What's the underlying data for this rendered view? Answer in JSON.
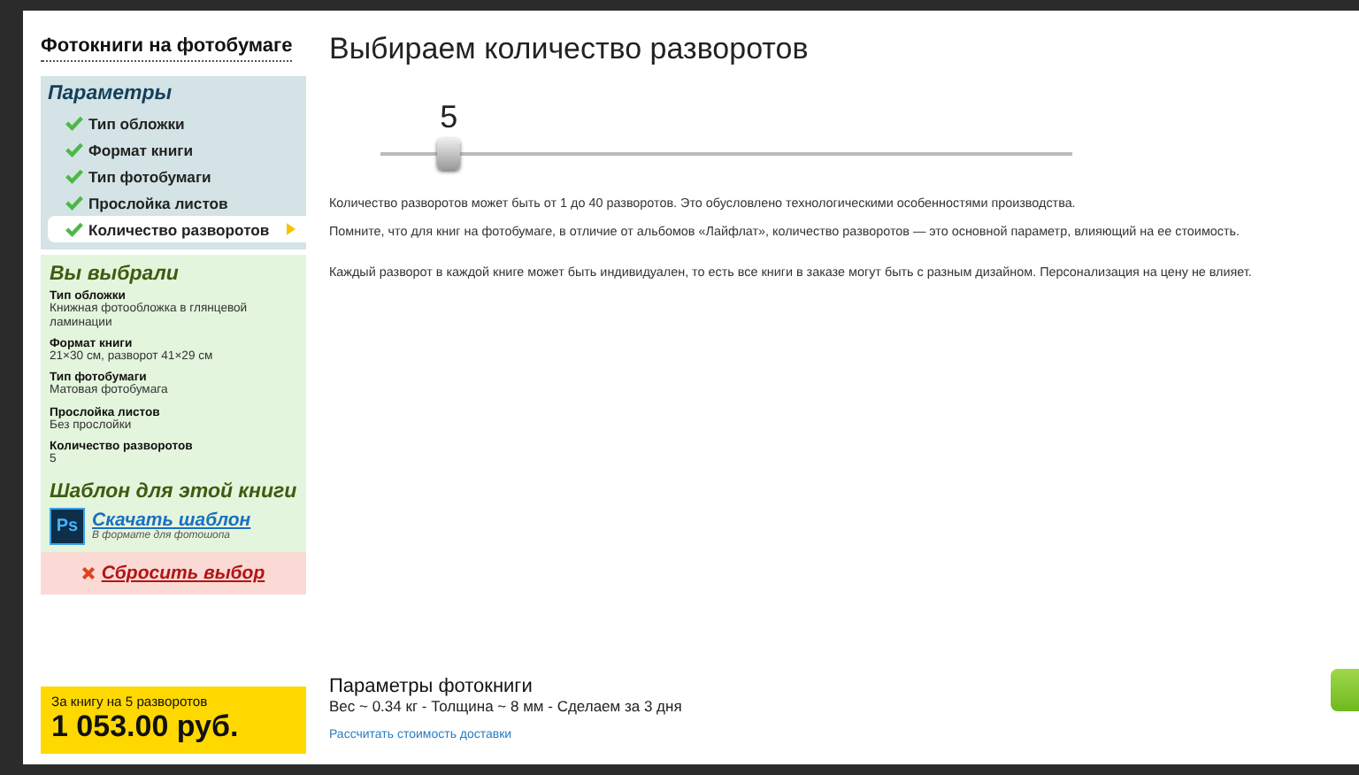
{
  "sidebar": {
    "title": "Фотокниги на фотобумаге",
    "params": {
      "heading": "Параметры",
      "steps": [
        {
          "label": "Тип обложки",
          "checked": true,
          "selected": false
        },
        {
          "label": "Формат книги",
          "checked": true,
          "selected": false
        },
        {
          "label": "Тип фотобумаги",
          "checked": true,
          "selected": false
        },
        {
          "label": "Прослойка листов",
          "checked": true,
          "selected": false
        },
        {
          "label": "Количество разворотов",
          "checked": true,
          "selected": true
        }
      ]
    },
    "chosen": {
      "heading": "Вы выбрали",
      "items": [
        {
          "name": "Тип обложки",
          "value": "Книжная фотообложка в глянцевой ламинации"
        },
        {
          "name": "Формат книги",
          "value": "21×30 см, разворот 41×29 см"
        },
        {
          "name": "Тип фотобумаги",
          "value": "Матовая фотобумага"
        },
        {
          "name": "Прослойка листов",
          "value": "Без прослойки"
        },
        {
          "name": "Количество разворотов",
          "value": "5"
        }
      ]
    },
    "template": {
      "heading": "Шаблон для этой книги",
      "icon_text": "Ps",
      "link": "Скачать шаблон",
      "note": "В формате для фотошопа"
    },
    "reset": "Сбросить выбор",
    "price": {
      "caption": "За книгу на 5 разворотов",
      "amount": "1 053.00 руб."
    }
  },
  "main": {
    "title": "Выбираем количество разворотов",
    "slider": {
      "value": "5",
      "level": 0.1
    },
    "paragraphs": [
      "Количество разворотов может быть от 1 до 40 разворотов. Это обусловлено технологическими особенностями производства.",
      "Помните, что для книг на фотобумаге, в отличие от альбомов «Лайфлат», количество разворотов — это основной параметр, влияющий на ее стоимость.",
      "Каждый разворот в каждой книге может быть индивидуален, то есть все книги в заказе могут быть с разным дизайном. Персонализация на цену не влияет."
    ],
    "summary": {
      "title": "Параметры фотокниги",
      "details": "Вес ~ 0.34 кг - Толщина ~ 8 мм - Сделаем за 3 дня",
      "link": "Рассчитать стоимость доставки"
    }
  }
}
